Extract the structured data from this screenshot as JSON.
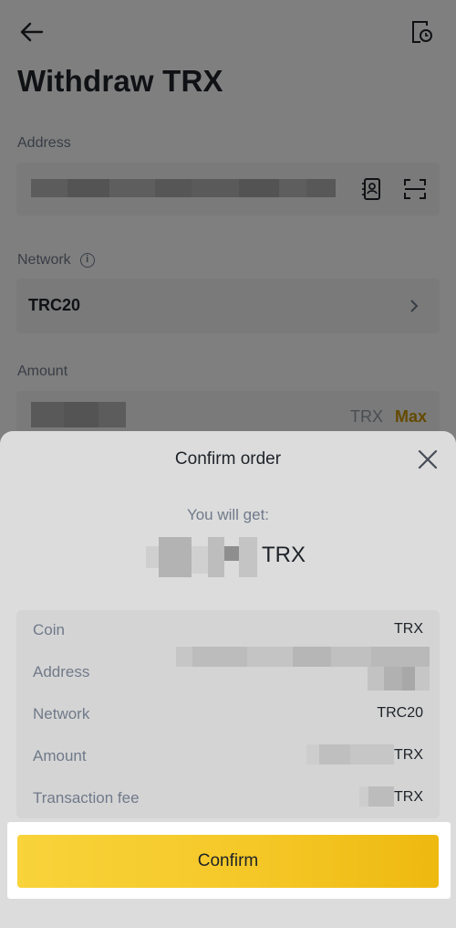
{
  "page": {
    "title": "Withdraw TRX",
    "address_label": "Address",
    "network_label": "Network",
    "network_value": "TRC20",
    "amount_label": "Amount",
    "amount_unit": "TRX",
    "max_label": "Max",
    "icons": {
      "back": "back-arrow-icon",
      "history": "history-icon",
      "address_book": "address-book-icon",
      "scan": "scan-icon",
      "info": "info-icon",
      "chevron": "chevron-right-icon"
    }
  },
  "sheet": {
    "title": "Confirm order",
    "you_get_label": "You will get:",
    "get_unit": "TRX",
    "rows": [
      {
        "label": "Coin",
        "value": "TRX"
      },
      {
        "label": "Address",
        "value": ""
      },
      {
        "label": "Network",
        "value": "TRC20"
      },
      {
        "label": "Amount",
        "value": "TRX"
      },
      {
        "label": "Transaction fee",
        "value": "TRX"
      }
    ],
    "confirm_label": "Confirm",
    "icons": {
      "close": "close-icon"
    }
  },
  "colors": {
    "accent": "#f0b90b",
    "max_text": "#c99400",
    "sheet_bg": "#dcdcdc"
  }
}
